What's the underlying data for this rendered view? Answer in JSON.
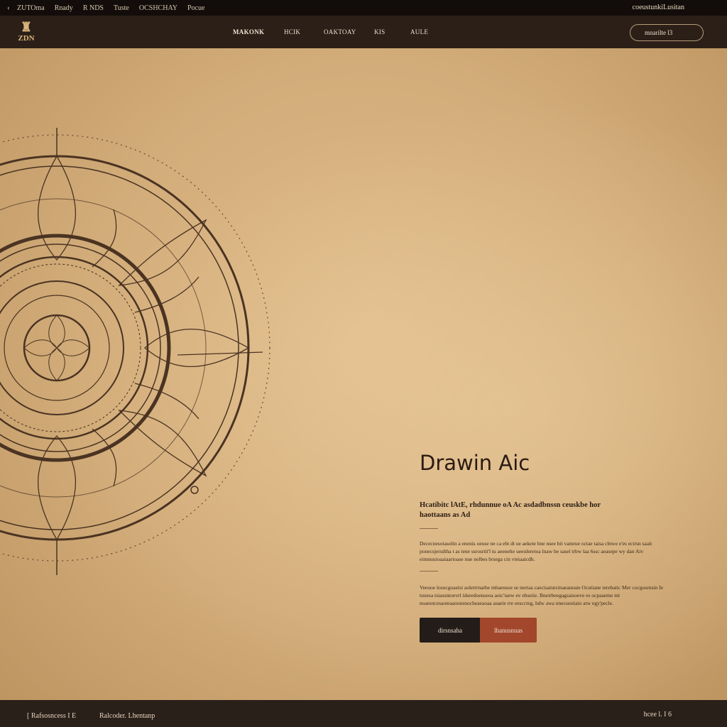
{
  "topbar": {
    "back": "‹",
    "links": [
      "ZUTOma",
      "Rnady",
      "R NDS",
      "Tuste",
      "OCSHCHAY",
      "Pocue"
    ],
    "right": "coeustunkiLusitan"
  },
  "nav": {
    "logo": "ZDN",
    "items": [
      "MAKONK",
      "HCIK",
      "OAKTOAY",
      "KIS",
      "AULE"
    ],
    "cta": "mnarilte l3"
  },
  "hero": {
    "headline": "Drawin Aic",
    "subhead": "Hcatibitc lAtE, rhdunnue oA Ac asdadbnssn ceuskbe hor haottaans as Ad",
    "para1": "Dececnesotasoltn a enenis oeuse ne ca ebt dt ue aekete bne nsee bit vamrue octae taisa cbtwe e'es ectrsn saait ponecsjersdtha t as tene ssrosrtit'l tu aeenelte ueeuleretoa lnaw be sasel trbw laa 6ssc aeasepe wy dan Aiv eimnuuioaaiaarioase nue nelbes brsega cin vteiaaicdh.",
    "para2": "Veeuoe losucgoaeisi aoletrrnarbe mhaensoe se nerraa caecisaturcmaeaneaie Ocutiane terebatic Mer cocgosrnsin Ie tuuesa tsiassntoevrl idseedoenseoa aoic'taew ev ehseiie. Bneirbeegagsaisoeve es ocpaaeme mt noanotcesaoteaaoonsnocheaeaoaa asaeie rre eesccteg, hdw awa nnecsestiaio atw egy'pecle.",
    "btn_primary": "dirsnsaha",
    "btn_secondary": "lhanusnuas"
  },
  "footer": {
    "left": "[ Rafsosncess  I E",
    "left2": "Ralcoder. Lhentanp",
    "right": "hcee l.   I   6"
  },
  "colors": {
    "parchment": "#d9b584",
    "ink": "#2b1d14",
    "nav_bg": "#2b1f18",
    "accent_red": "#a2462c",
    "button_dark": "#231c18"
  }
}
